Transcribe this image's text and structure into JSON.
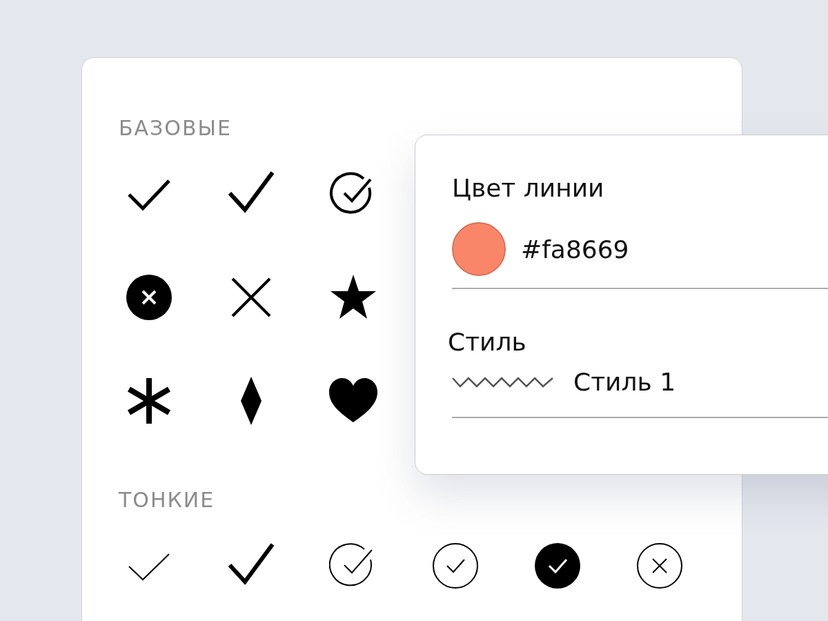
{
  "sections": [
    {
      "title": "БАЗОВЫЕ",
      "icons": [
        {
          "kind": "check"
        },
        {
          "kind": "check-bold"
        },
        {
          "kind": "check-circle-open"
        },
        {
          "kind": "x-circle-filled"
        },
        {
          "kind": "x"
        },
        {
          "kind": "star"
        },
        {
          "kind": "asterisk"
        },
        {
          "kind": "diamond"
        },
        {
          "kind": "heart"
        }
      ]
    },
    {
      "title": "ТОНКИЕ",
      "icons": [
        {
          "kind": "check-thin"
        },
        {
          "kind": "check-bold"
        },
        {
          "kind": "check-circle-open-thin"
        },
        {
          "kind": "check-circle-thin"
        },
        {
          "kind": "check-circle-filled"
        },
        {
          "kind": "x-circle-thin"
        }
      ]
    }
  ],
  "popup": {
    "color_label": "Цвет линии",
    "color": {
      "value": "#fa8669",
      "color": "#fa8669"
    },
    "style_label": "Стиль",
    "style": {
      "kind": "zigzag",
      "value": "Стиль 1"
    }
  }
}
